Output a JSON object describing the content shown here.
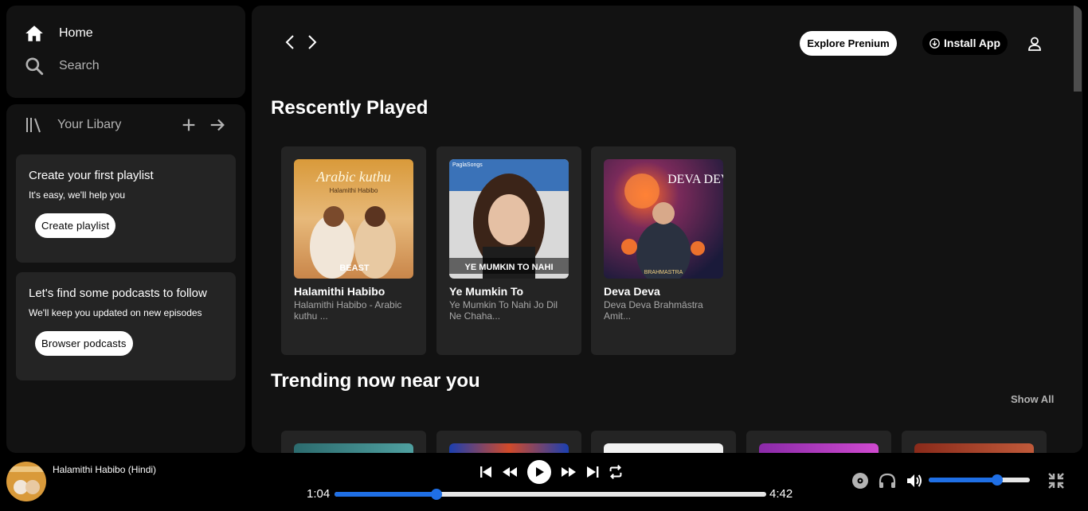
{
  "sidebar": {
    "home_label": "Home",
    "search_label": "Search",
    "library_label": "Your Libary",
    "playlist_card": {
      "title": "Create your first playlist",
      "subtitle": "It's easy, we'll help you",
      "button": "Create playlist"
    },
    "podcast_card": {
      "title": "Let's find some podcasts to follow",
      "subtitle": "We'll keep you updated on new episodes",
      "button": "Browser podcasts"
    }
  },
  "header": {
    "premium_label": "Explore Prenium",
    "install_label": "Install App"
  },
  "recent": {
    "title": "Rescently Played",
    "items": [
      {
        "name": "Halamithi Habibo",
        "desc": "Halamithi Habibo - Arabic kuthu ...",
        "cover_text": "Arabic kuthu",
        "cover_sub": "Halamithi Habibo",
        "cover_tag": "BEAST"
      },
      {
        "name": "Ye Mumkin To",
        "desc": "Ye Mumkin To Nahi Jo Dil Ne Chaha...",
        "cover_text": "YE MUMKIN TO NAHI",
        "cover_brand": "PaglaSongs"
      },
      {
        "name": "Deva Deva",
        "desc": "Deva Deva Brahmāstra Amit...",
        "cover_text": "DEVA DEVA",
        "cover_tag": "BRAHMASTRA"
      }
    ]
  },
  "trending": {
    "title": "Trending now near you",
    "show_all": "Show All"
  },
  "player": {
    "track_title": "Halamithi Habibo (Hindi)",
    "current_time": "1:04",
    "total_time": "4:42",
    "progress": 0.236,
    "volume": 0.68
  },
  "colors": {
    "accent": "#1f6fe5",
    "panel": "#121212",
    "card": "#242424"
  }
}
